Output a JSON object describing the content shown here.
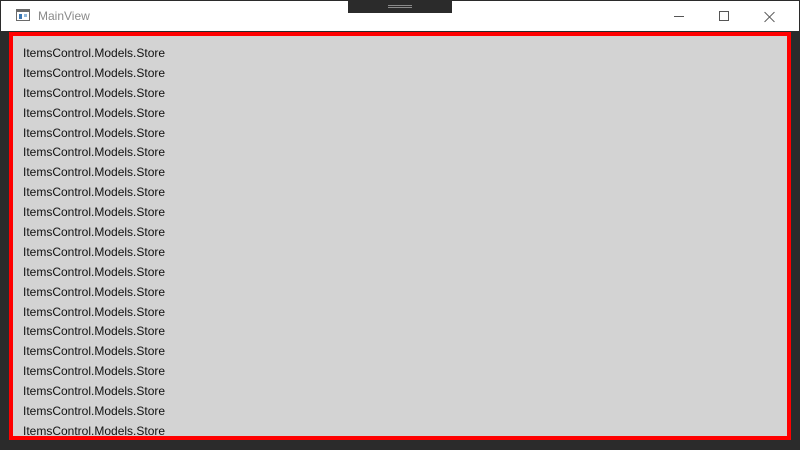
{
  "window": {
    "title": "MainView",
    "icon": "window-app-icon"
  },
  "caption_buttons": {
    "minimize_icon": "minimize-icon",
    "maximize_icon": "maximize-icon",
    "close_icon": "close-icon"
  },
  "colors": {
    "border_accent": "#ff0000",
    "content_background": "#d3d3d3"
  },
  "list": {
    "items": [
      "ItemsControl.Models.Store",
      "ItemsControl.Models.Store",
      "ItemsControl.Models.Store",
      "ItemsControl.Models.Store",
      "ItemsControl.Models.Store",
      "ItemsControl.Models.Store",
      "ItemsControl.Models.Store",
      "ItemsControl.Models.Store",
      "ItemsControl.Models.Store",
      "ItemsControl.Models.Store",
      "ItemsControl.Models.Store",
      "ItemsControl.Models.Store",
      "ItemsControl.Models.Store",
      "ItemsControl.Models.Store",
      "ItemsControl.Models.Store",
      "ItemsControl.Models.Store",
      "ItemsControl.Models.Store",
      "ItemsControl.Models.Store",
      "ItemsControl.Models.Store",
      "ItemsControl.Models.Store"
    ]
  }
}
